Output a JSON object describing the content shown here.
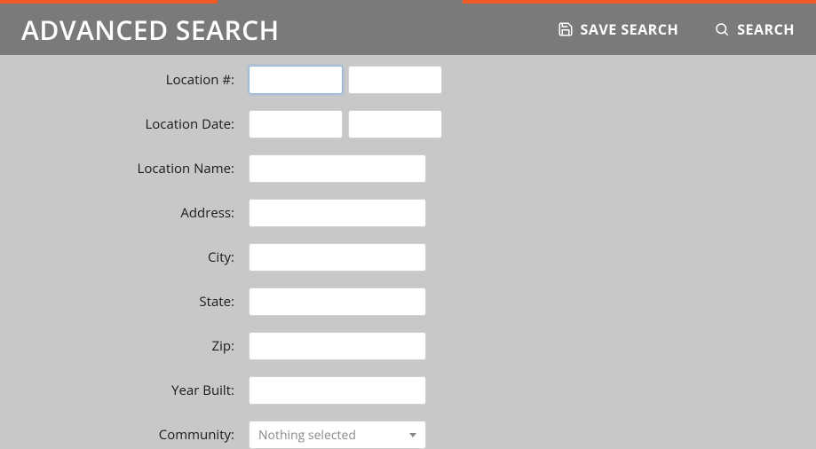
{
  "accent": {
    "orange": "#f15a24",
    "gray": "#7a7a7a",
    "segments": [
      {
        "color": "orange",
        "flex": 1.6
      },
      {
        "color": "gray",
        "flex": 1.8
      },
      {
        "color": "orange",
        "flex": 2.6
      }
    ]
  },
  "header": {
    "title": "ADVANCED SEARCH",
    "actions": {
      "save_search": "SAVE SEARCH",
      "search": "SEARCH"
    }
  },
  "form": {
    "location_number": {
      "label": "Location #:",
      "from": "",
      "to": ""
    },
    "location_date": {
      "label": "Location Date:",
      "from": "",
      "to": ""
    },
    "location_name": {
      "label": "Location Name:",
      "value": ""
    },
    "address": {
      "label": "Address:",
      "value": ""
    },
    "city": {
      "label": "City:",
      "value": ""
    },
    "state": {
      "label": "State:",
      "value": ""
    },
    "zip": {
      "label": "Zip:",
      "value": ""
    },
    "year_built": {
      "label": "Year Built:",
      "value": ""
    },
    "community": {
      "label": "Community:",
      "placeholder": "Nothing selected",
      "selected": ""
    }
  }
}
